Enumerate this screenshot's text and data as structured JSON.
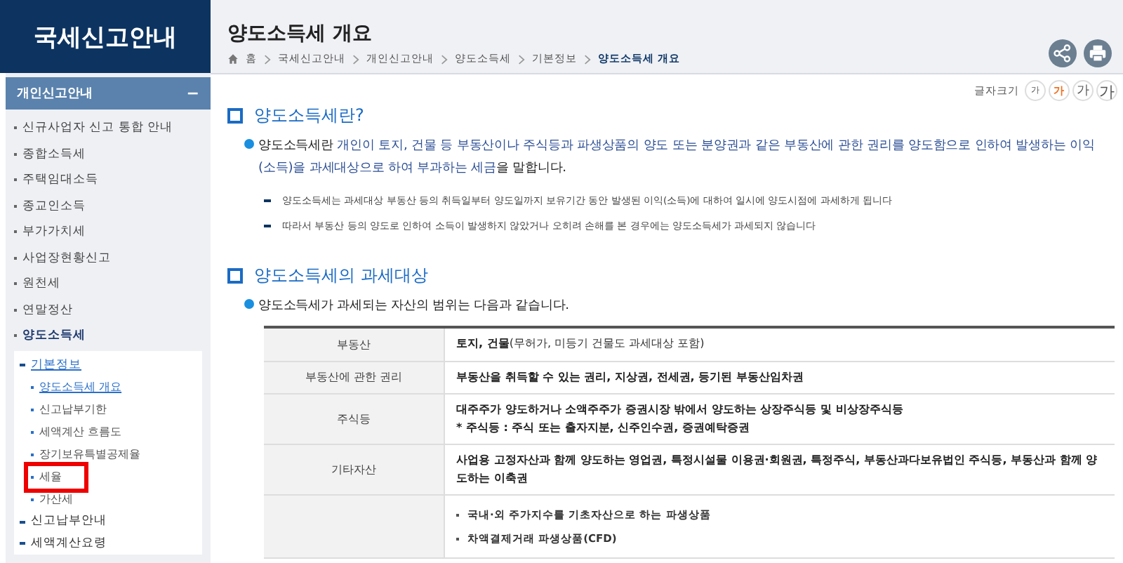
{
  "sidebar": {
    "title": "국세신고안내",
    "section": {
      "label": "개인신고안내",
      "toggle": "−"
    },
    "items": [
      {
        "label": "신규사업자 신고 통합 안내",
        "selected": false
      },
      {
        "label": "종합소득세",
        "selected": false
      },
      {
        "label": "주택임대소득",
        "selected": false
      },
      {
        "label": "종교인소득",
        "selected": false
      },
      {
        "label": "부가가치세",
        "selected": false
      },
      {
        "label": "사업장현황신고",
        "selected": false
      },
      {
        "label": "원천세",
        "selected": false
      },
      {
        "label": "연말정산",
        "selected": false
      },
      {
        "label": "양도소득세",
        "selected": true,
        "children": [
          {
            "label": "기본정보",
            "selected": true,
            "children": [
              {
                "label": "양도소득세 개요",
                "selected": true,
                "highlighted": false
              },
              {
                "label": "신고납부기한",
                "selected": false,
                "highlighted": false
              },
              {
                "label": "세액계산 흐름도",
                "selected": false,
                "highlighted": false
              },
              {
                "label": "장기보유특별공제율",
                "selected": false,
                "highlighted": false
              },
              {
                "label": "세율",
                "selected": false,
                "highlighted": true
              },
              {
                "label": "가산세",
                "selected": false,
                "highlighted": false
              }
            ]
          },
          {
            "label": "신고납부안내",
            "selected": false
          },
          {
            "label": "세액계산요령",
            "selected": false
          }
        ]
      }
    ]
  },
  "header": {
    "title": "양도소득세 개요",
    "breadcrumb": [
      {
        "label": "홈",
        "selected": false
      },
      {
        "label": "국세신고안내",
        "selected": false
      },
      {
        "label": "개인신고안내",
        "selected": false
      },
      {
        "label": "양도소득세",
        "selected": false
      },
      {
        "label": "기본정보",
        "selected": false
      },
      {
        "label": "양도소득세 개요",
        "selected": true
      }
    ]
  },
  "font_size": {
    "label": "글자크기",
    "options": [
      {
        "label": "가",
        "selected": false
      },
      {
        "label": "가",
        "selected": true
      },
      {
        "label": "가",
        "selected": false
      },
      {
        "label": "가",
        "selected": false
      }
    ]
  },
  "sections": [
    {
      "heading": "양도소득세란?",
      "lead": [
        {
          "text": "양도소득세란 ",
          "kind": "plain"
        },
        {
          "text": "개인이 토지, 건물 등 부동산이나 주식등과 파생상품의 양도 또는 분양권과 같은 부동산에 관한 권리를 양도함으로 인하여 발생하는 이익(소득)을 과세대상으로 하여 부과하는 세금",
          "kind": "accent"
        },
        {
          "text": "을 말합니다.",
          "kind": "plain"
        }
      ],
      "notes": [
        "양도소득세는 과세대상 부동산 등의 취득일부터 양도일까지 보유기간 동안 발생된 이익(소득)에 대하여 일시에 양도시점에 과세하게 됩니다",
        "따라서 부동산 등의 양도로 인하여 소득이 발생하지 않았거나 오히려 손해를 본 경우에는 양도소득세가 과세되지 않습니다"
      ]
    },
    {
      "heading": "양도소득세의 과세대상",
      "lead": [
        {
          "text": "양도소득세가 과세되는 자산의 범위는 다음과 같습니다.",
          "kind": "plain"
        }
      ]
    }
  ],
  "table": {
    "rows": [
      {
        "label": "부동산",
        "lines": [
          {
            "text": "**토지, 건물**(무허가, 미등기 건물도 과세대상 포함)",
            "bold": false
          }
        ]
      },
      {
        "label": "부동산에 관한 권리",
        "lines": [
          {
            "text": "부동산을 취득할 수 있는 권리, 지상권, 전세권, 등기된 부동산임차권",
            "bold": true
          }
        ]
      },
      {
        "label": "주식등",
        "lines": [
          {
            "text": "대주주가 양도하거나 소액주주가 증권시장 밖에서 양도하는 상장주식등 및 비상장주식등",
            "bold": true
          },
          {
            "text": "* 주식등 : 주식 또는 출자지분, 신주인수권, 증권예탁증권",
            "bold": true
          }
        ]
      },
      {
        "label": "기타자산",
        "lines": [
          {
            "text": "사업용 고정자산과 함께 양도하는 영업권, 특정시설물 이용권·회원권, 특정주식, 부동산과다보유법인 주식등, 부동산과 함께 양도하는 이축권",
            "bold": true
          }
        ]
      },
      {
        "label": "",
        "bullets": [
          "국내·외 주가지수를 기초자산으로 하는 파생상품",
          "차액결제거래 파생상품(CFD)"
        ]
      }
    ]
  }
}
